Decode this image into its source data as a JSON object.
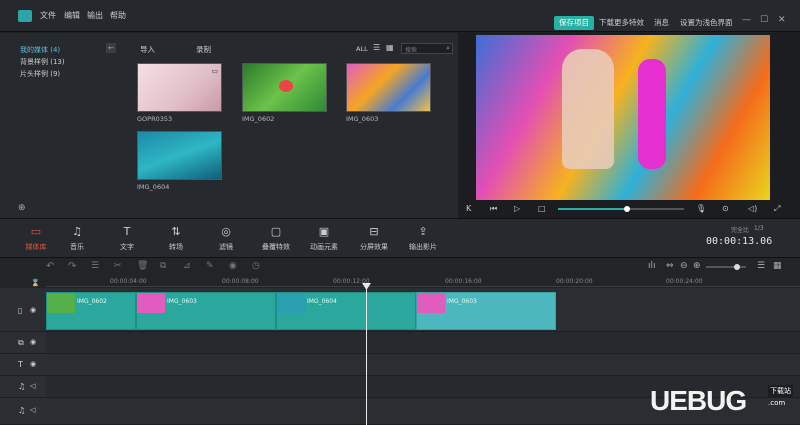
{
  "menu": {
    "file": "文件",
    "edit": "编辑",
    "export": "输出",
    "help": "帮助"
  },
  "top": {
    "save_project": "保存项目",
    "more_effects": "下载更多特效",
    "messages": "消息",
    "settings": "设置为浅色界面"
  },
  "library": {
    "items": [
      {
        "label": "我的媒体 (4)"
      },
      {
        "label": "背景样例 (13)"
      },
      {
        "label": "片头样例 (9)"
      }
    ]
  },
  "media_toolbar": {
    "import": "导入",
    "record": "录制",
    "all": "ALL",
    "search_placeholder": "搜索"
  },
  "media": [
    {
      "name": "GOPR0353",
      "color": "#e9d6db"
    },
    {
      "name": "IMG_0602",
      "color": "#55b04a"
    },
    {
      "name": "IMG_0603",
      "color": "#e25cc0"
    },
    {
      "name": "IMG_0604",
      "color": "#2a9fb0"
    }
  ],
  "tools": [
    {
      "label": "媒体库",
      "icon": "folder-icon",
      "active": true
    },
    {
      "label": "音乐",
      "icon": "music-icon"
    },
    {
      "label": "文字",
      "icon": "text-icon"
    },
    {
      "label": "转场",
      "icon": "transition-icon"
    },
    {
      "label": "滤镜",
      "icon": "filter-icon"
    },
    {
      "label": "叠覆特效",
      "icon": "overlay-icon"
    },
    {
      "label": "动画元素",
      "icon": "elements-icon"
    },
    {
      "label": "分屏效果",
      "icon": "split-screen-icon"
    },
    {
      "label": "输出影片",
      "icon": "export-icon"
    }
  ],
  "playhead": {
    "time": "00:00:13.06",
    "label": "完全比",
    "value": "1/3",
    "progress": 0.55
  },
  "ruler": [
    "00:00:04:00",
    "00:00:08:00",
    "00:00:12:00",
    "00:00:16:00",
    "00:00:20:00",
    "00:00:24:00"
  ],
  "clips": [
    {
      "label": "IMG_0602",
      "color": "#55b04a"
    },
    {
      "label": "IMG_0603",
      "color": "#e25cc0"
    },
    {
      "label": "IMG_0604",
      "color": "#2a9fb0"
    },
    {
      "label": "IMG_0603",
      "color": "#e25cc0"
    }
  ],
  "watermark": {
    "brand": "UEBUG",
    "sub": "下载站",
    "dotcom": ".com"
  }
}
